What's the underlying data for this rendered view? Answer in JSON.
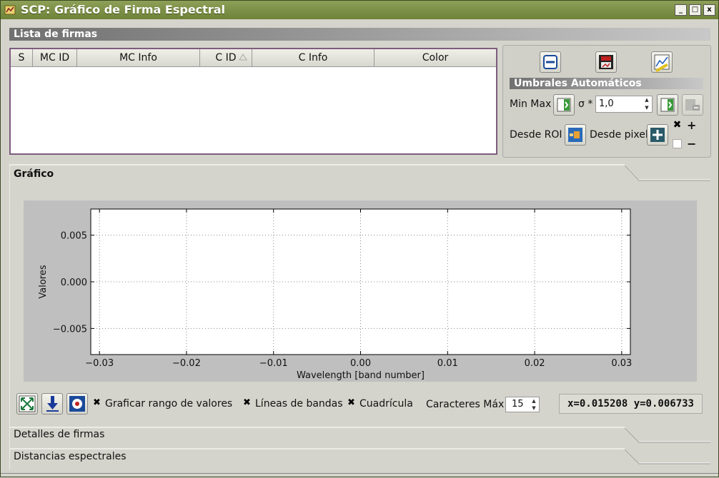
{
  "window": {
    "title": "SCP: Gráfico de Firma Espectral",
    "buttons": [
      "_",
      "□",
      "x"
    ]
  },
  "signature_list": {
    "header": "Lista de firmas",
    "columns": [
      "S",
      "MC ID",
      "MC Info",
      "C ID",
      "C Info",
      "Color"
    ],
    "rows": []
  },
  "auto_thresholds": {
    "header": "Umbrales  Automáticos",
    "min_max_label": "Min Max",
    "sigma_label": "σ *",
    "sigma_value": "1,0",
    "from_roi_label": "Desde ROI",
    "from_pixel_label": "Desde pixel",
    "plus_label": "+",
    "minus_label": "−"
  },
  "graph_group": {
    "title": "Gráfico"
  },
  "chart_data": {
    "type": "line",
    "xlabel": "Wavelength [band number]",
    "ylabel": "Valores",
    "xlim": [
      -0.031,
      0.031
    ],
    "ylim": [
      0.0078,
      -0.0078
    ],
    "xticks": [
      -0.03,
      -0.02,
      -0.01,
      0.0,
      0.01,
      0.02,
      0.03
    ],
    "xtick_labels": [
      "−0.03",
      "−0.02",
      "−0.01",
      "0.00",
      "0.01",
      "0.02",
      "0.03"
    ],
    "yticks": [
      -0.005,
      0.0,
      0.005
    ],
    "ytick_labels": [
      "−0.005",
      "0.000",
      "0.005"
    ],
    "grid": true,
    "series": []
  },
  "plot_options": {
    "plot_range_label": "Graficar rango de valores",
    "band_lines_label": "Líneas de bandas",
    "grid_label": "Cuadrícula",
    "max_chars_label": "Caracteres Máx",
    "max_chars_value": "15",
    "coords": "x=0.015208 y=0.006733"
  },
  "collapsed_groups": {
    "signature_details": "Detalles de firmas",
    "spectral_distances": "Distancias espectrales"
  }
}
